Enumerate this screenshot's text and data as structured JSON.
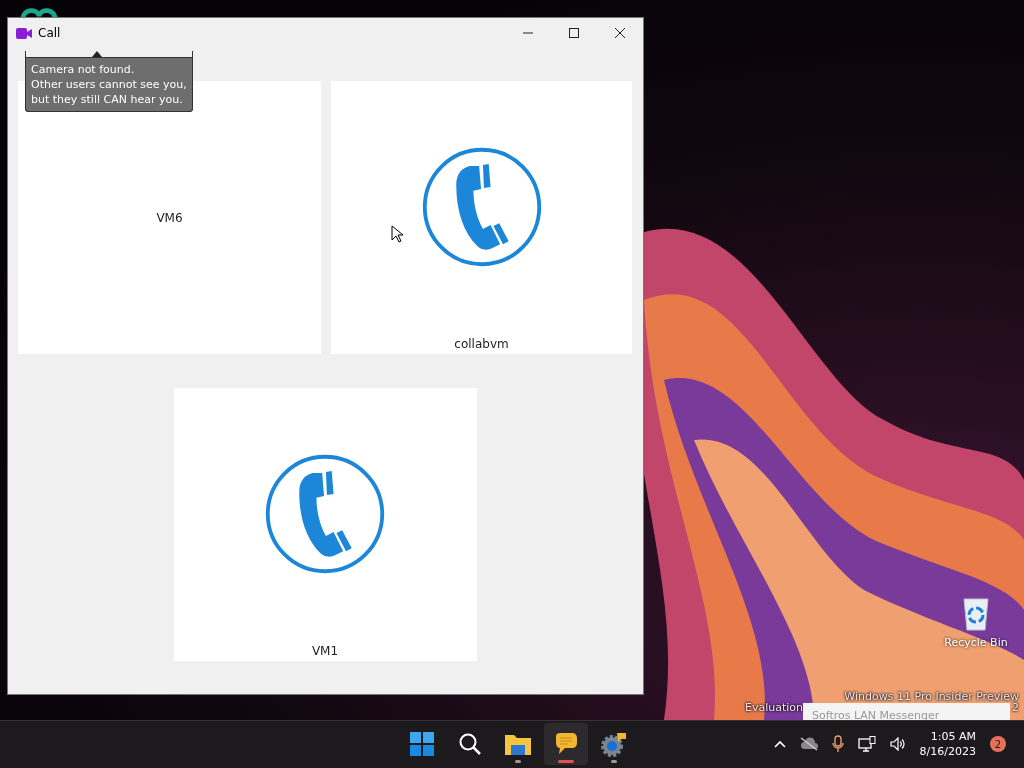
{
  "window": {
    "title": "Call"
  },
  "tooltip": {
    "text": "Camera not found.\nOther users cannot see you,\nbut they still CAN hear you."
  },
  "tiles": [
    {
      "name": "VM6",
      "kind": "blank"
    },
    {
      "name": "collabvm",
      "kind": "phone"
    },
    {
      "name": "VM1",
      "kind": "phone"
    }
  ],
  "desktop": {
    "icons": [
      {
        "label": "Recycle Bin"
      }
    ],
    "watermark": {
      "line_1": "Windows 11 Pro Insider Preview",
      "line_2": "Evaluation",
      "line_2_end": "2"
    },
    "notification_popup": {
      "title": "Softros LAN Messenger"
    }
  },
  "taskbar": {
    "apps": [
      {
        "kind": "start",
        "running": false,
        "needs_attention": false
      },
      {
        "kind": "search",
        "running": false,
        "needs_attention": false
      },
      {
        "kind": "folder",
        "running": true,
        "needs_attention": false
      },
      {
        "kind": "chat",
        "running": true,
        "needs_attention": true
      },
      {
        "kind": "settings",
        "running": true,
        "needs_attention": false
      }
    ],
    "tray": {
      "time": "1:05 AM",
      "date": "8/16/2023",
      "notification_count": "2"
    }
  }
}
